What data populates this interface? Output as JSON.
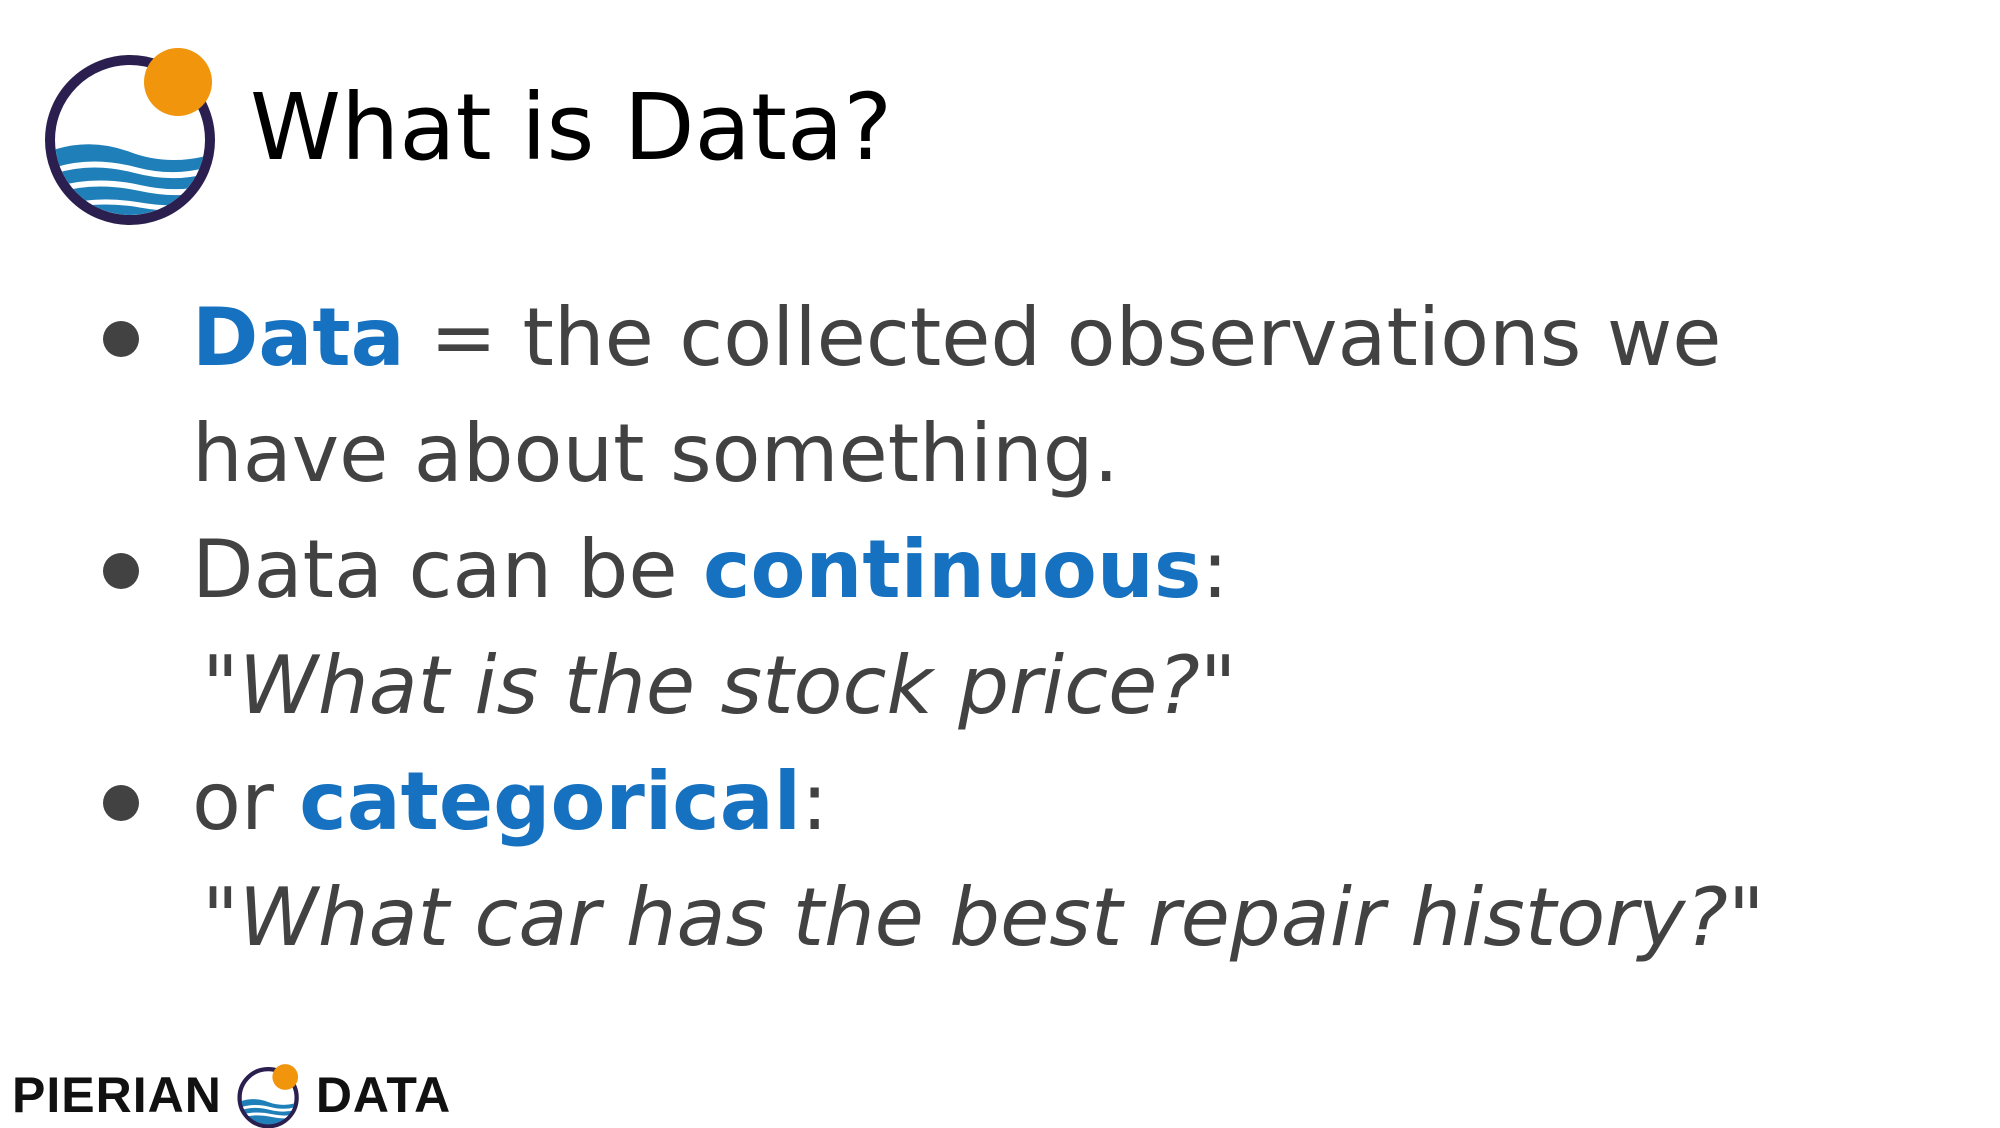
{
  "slide": {
    "title": "What is Data?",
    "bullets": [
      {
        "highlight": "Data",
        "text_line1": " = the collected observations we",
        "text_line2": "have about something."
      },
      {
        "prefix": "Data can be ",
        "highlight": "continuous",
        "suffix": ":",
        "quote": "\"What is the stock price?\""
      },
      {
        "prefix": "or ",
        "highlight": "categorical",
        "suffix": ":",
        "quote": "\"What car has the best repair history?\""
      }
    ]
  },
  "footer": {
    "brand_left": "PIERIAN",
    "brand_right": "DATA"
  },
  "icons": {
    "header_logo": "pierian-data-logo-icon",
    "footer_logo": "pierian-data-logo-icon"
  },
  "colors": {
    "highlight": "#1671c0",
    "body_text": "#424242",
    "logo_ring": "#2a1f4f",
    "logo_sun": "#f0950c",
    "logo_wave": "#1f7fb8"
  }
}
